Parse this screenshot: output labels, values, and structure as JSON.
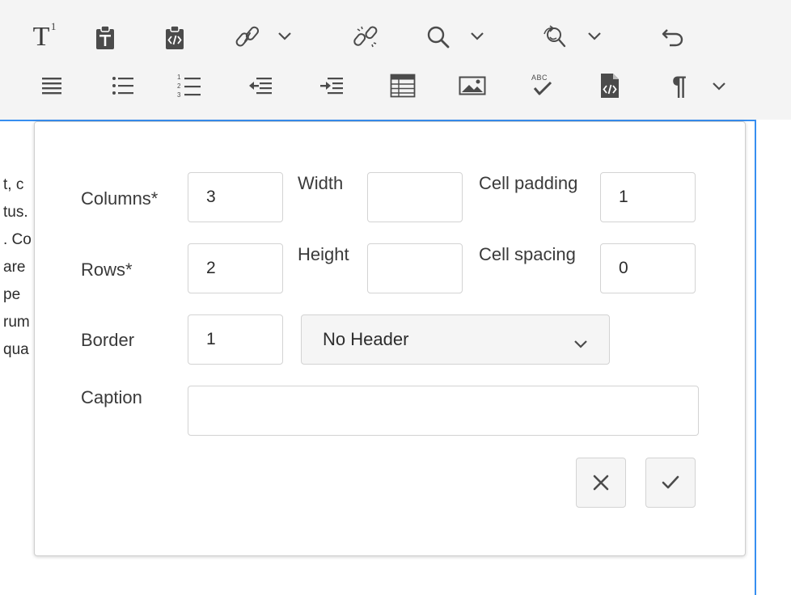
{
  "toolbar": {
    "row1": [
      {
        "name": "superscript-icon",
        "label": "T",
        "sup": "1"
      },
      {
        "name": "paste-icon"
      },
      {
        "name": "paste-code-icon"
      },
      {
        "name": "link-icon"
      },
      {
        "name": "unlink-icon"
      },
      {
        "name": "find-icon"
      },
      {
        "name": "find-replace-icon"
      },
      {
        "name": "undo-icon"
      }
    ],
    "row2": [
      {
        "name": "justify-icon"
      },
      {
        "name": "bulleted-list-icon"
      },
      {
        "name": "numbered-list-icon"
      },
      {
        "name": "outdent-icon"
      },
      {
        "name": "indent-icon"
      },
      {
        "name": "table-icon"
      },
      {
        "name": "image-icon"
      },
      {
        "name": "spellcheck-icon",
        "label": "ABC"
      },
      {
        "name": "source-edit-icon"
      },
      {
        "name": "paragraph-icon",
        "label": "¶"
      }
    ]
  },
  "background_text": [
    "t, c",
    "tus.",
    ". Co",
    "are",
    "pe",
    "rum",
    "qua"
  ],
  "dialog": {
    "columns": {
      "label": "Columns*",
      "value": "3"
    },
    "rows": {
      "label": "Rows*",
      "value": "2"
    },
    "border": {
      "label": "Border",
      "value": "1"
    },
    "caption": {
      "label": "Caption",
      "value": ""
    },
    "width": {
      "label": "Width",
      "value": ""
    },
    "height": {
      "label": "Height",
      "value": ""
    },
    "cell_padding": {
      "label": "Cell padding",
      "value": "1"
    },
    "cell_spacing": {
      "label": "Cell spacing",
      "value": "0"
    },
    "header_select": {
      "value": "No Header"
    },
    "cancel_icon": "close-icon",
    "confirm_icon": "checkmark-icon"
  },
  "colors": {
    "focus_border": "#378ef0",
    "toolbar_bg": "#f4f4f4",
    "icon": "#4b4b4b"
  }
}
